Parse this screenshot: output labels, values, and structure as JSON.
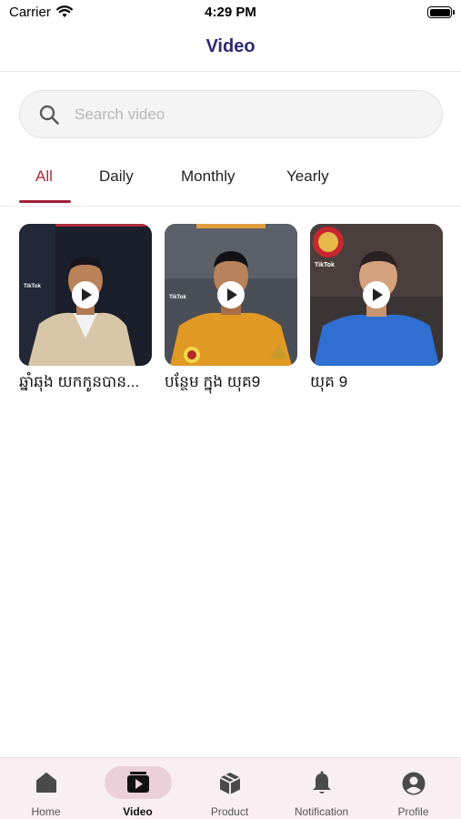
{
  "status_bar": {
    "carrier": "Carrier",
    "time": "4:29 PM"
  },
  "header": {
    "title": "Video"
  },
  "search": {
    "placeholder": "Search video",
    "value": ""
  },
  "tabs": [
    {
      "label": "All",
      "active": true
    },
    {
      "label": "Daily",
      "active": false
    },
    {
      "label": "Monthly",
      "active": false
    },
    {
      "label": "Yearly",
      "active": false
    }
  ],
  "videos": [
    {
      "title": "ឆ្នាំឆុង យកកូនបាន...",
      "watermark": "TikTok"
    },
    {
      "title": "បន្ថែម ក្នុង យុគ9",
      "watermark": "TikTok"
    },
    {
      "title": "យុគ 9",
      "watermark": "TikTok"
    }
  ],
  "bottom_nav": [
    {
      "label": "Home",
      "icon": "home-icon",
      "active": false
    },
    {
      "label": "Video",
      "icon": "video-icon",
      "active": true
    },
    {
      "label": "Product",
      "icon": "box-icon",
      "active": false
    },
    {
      "label": "Notification",
      "icon": "bell-icon",
      "active": false
    },
    {
      "label": "Profile",
      "icon": "user-circle-icon",
      "active": false
    }
  ],
  "colors": {
    "accent": "#a0203a",
    "title": "#2d2a6e",
    "bottom_bar_bg": "#f9eef2",
    "active_pill": "#ecd0d9"
  }
}
